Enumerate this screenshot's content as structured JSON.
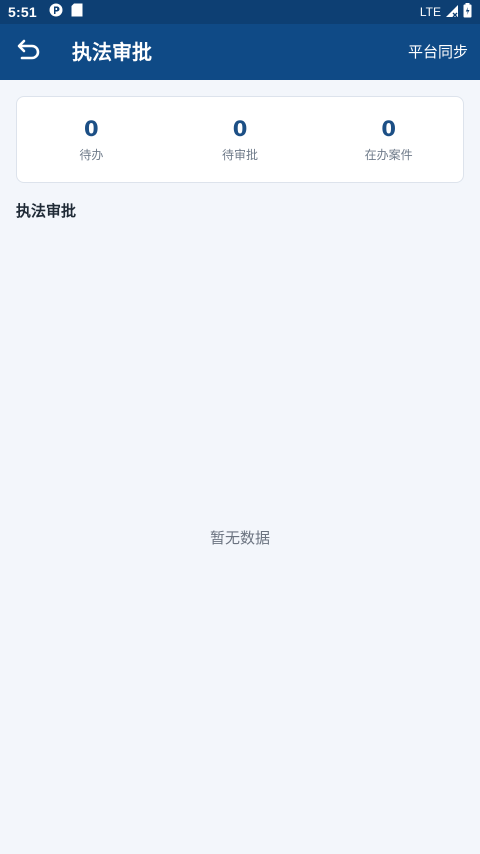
{
  "status_bar": {
    "time": "5:51",
    "network": "LTE",
    "icons": [
      "app-notification-icon",
      "sd-card-icon",
      "signal-icon",
      "battery-icon"
    ]
  },
  "app_bar": {
    "back_icon": "back-arrow-icon",
    "title": "执法审批",
    "action_label": "平台同步"
  },
  "stats": [
    {
      "value": "0",
      "label": "待办"
    },
    {
      "value": "0",
      "label": "待审批"
    },
    {
      "value": "0",
      "label": "在办案件"
    }
  ],
  "section": {
    "title": "执法审批"
  },
  "empty_state": {
    "text": "暂无数据"
  },
  "colors": {
    "status_bar": "#0d3f73",
    "app_bar": "#0f4a86",
    "accent_number": "#1c4f85",
    "background": "#f3f6fb"
  }
}
